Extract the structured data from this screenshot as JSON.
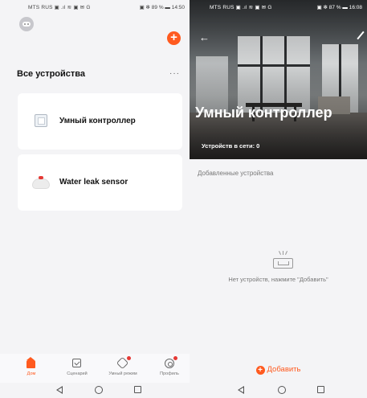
{
  "left": {
    "status": {
      "carrier": "MTS RUS ▣ .ıl ≋ ▣ ✉ G",
      "right": "▣ ✻ 89 % ▬ 14:50"
    },
    "section_title": "Все устройства",
    "more": "···",
    "devices": [
      {
        "name": "Умный контроллер",
        "icon": "controller-icon"
      },
      {
        "name": "Water leak sensor",
        "icon": "water-leak-sensor-icon"
      }
    ],
    "nav": [
      {
        "label": "Дом",
        "icon": "home-icon",
        "active": true
      },
      {
        "label": "Сценарий",
        "icon": "scene-icon",
        "active": false
      },
      {
        "label": "Умный режим",
        "icon": "smart-mode-icon",
        "active": false,
        "badge": true
      },
      {
        "label": "Профиль",
        "icon": "profile-icon",
        "active": false,
        "badge": true
      }
    ]
  },
  "right": {
    "status": {
      "carrier": "MTS RUS ▣ .ıl ≋ ▣ ✉ G",
      "right": "▣ ✻ 87 % ▬ 16:08"
    },
    "title": "Умный контроллер",
    "online": "Устройств в сети: 0",
    "added_title": "Добавленные устройства",
    "empty_text": "Нет устройств, нажмите \"Добавить\"",
    "add_label": "Добавить"
  },
  "colors": {
    "accent": "#ff5a1f",
    "badge": "#e53935",
    "background": "#f4f4f6"
  }
}
